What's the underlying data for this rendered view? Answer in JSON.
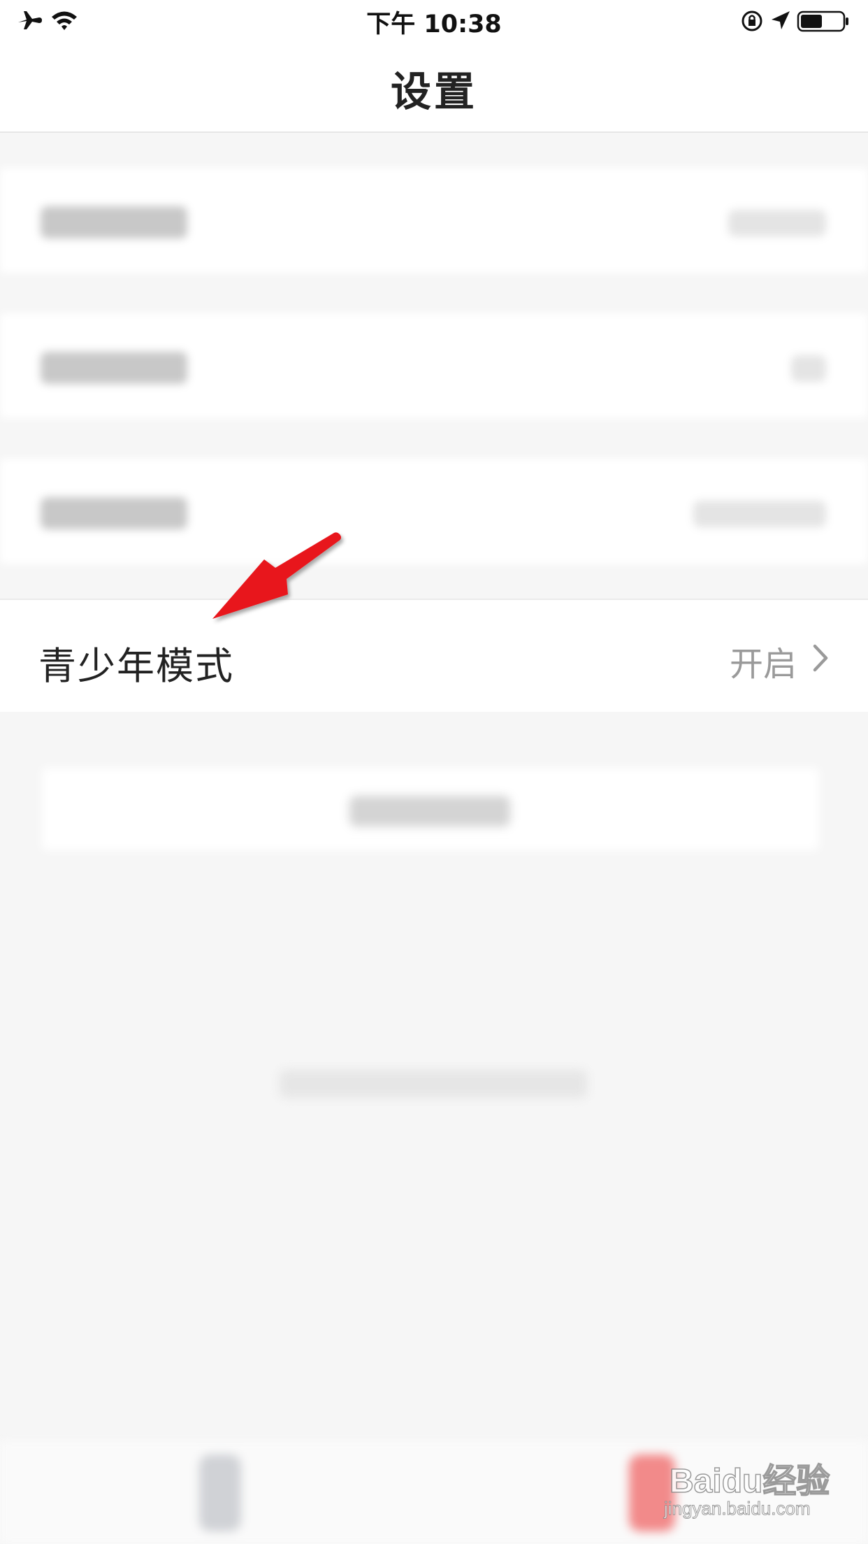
{
  "status_bar": {
    "time": "下午 10:38",
    "icons_left": [
      "airplane-icon",
      "wifi-icon"
    ],
    "icons_right": [
      "orientation-lock-icon",
      "location-icon",
      "battery-icon"
    ]
  },
  "header": {
    "title": "设置"
  },
  "settings": {
    "teen_mode": {
      "label": "青少年模式",
      "value": "开启"
    }
  },
  "watermark": {
    "brand": "Baidu经验",
    "url": "jingyan.baidu.com"
  },
  "colors": {
    "annotation_arrow": "#e8141c",
    "background": "#f6f6f6",
    "value_text": "#9a9a9a"
  }
}
